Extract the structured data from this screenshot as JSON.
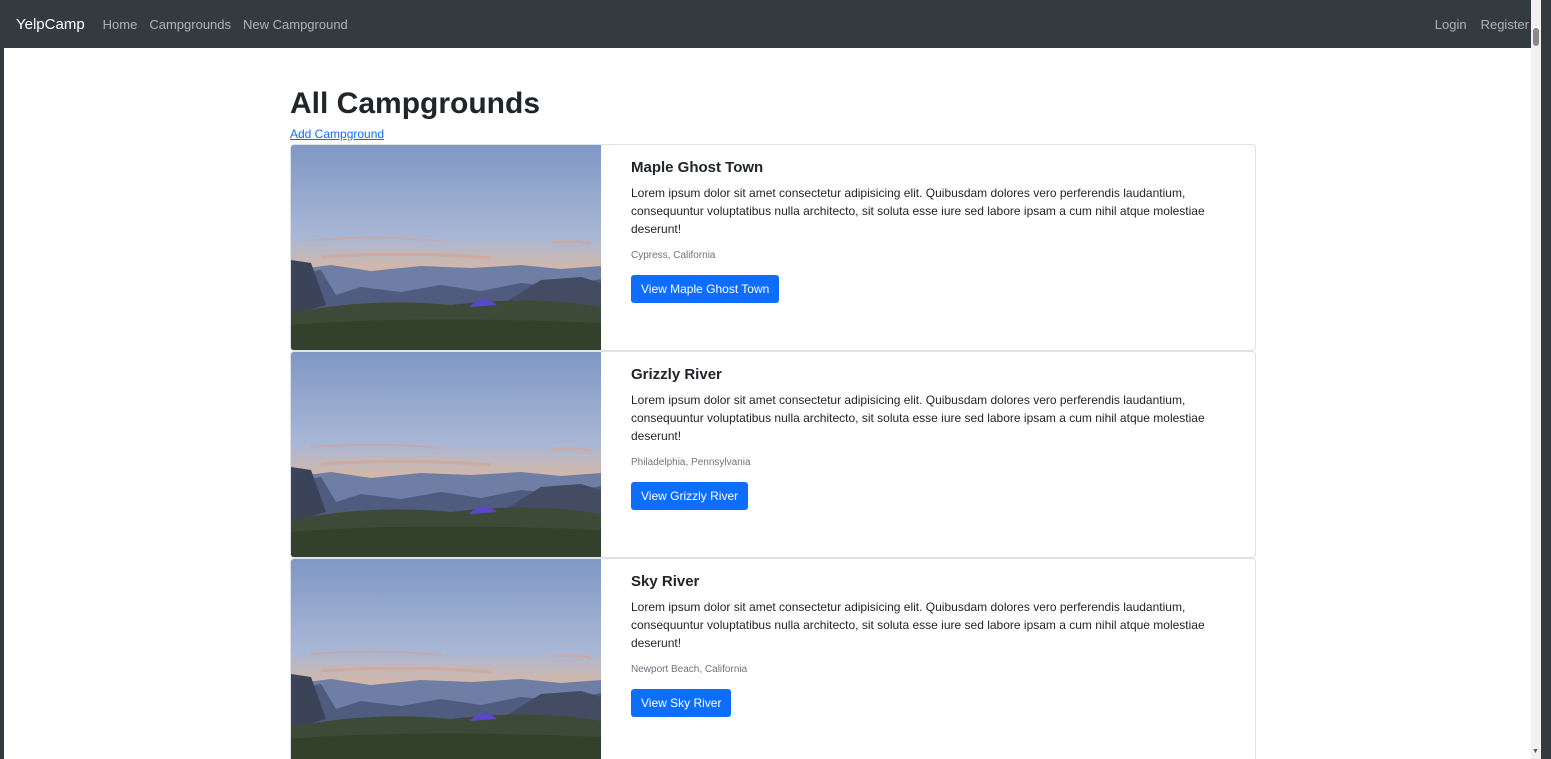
{
  "navbar": {
    "brand": "YelpCamp",
    "links": [
      "Home",
      "Campgrounds",
      "New Campground"
    ],
    "right_links": [
      "Login",
      "Register"
    ]
  },
  "page": {
    "title": "All Campgrounds",
    "add_link": "Add Campground"
  },
  "campgrounds": [
    {
      "title": "Maple Ghost Town",
      "description": "Lorem ipsum dolor sit amet consectetur adipisicing elit. Quibusdam dolores vero perferendis laudantium, consequuntur voluptatibus nulla architecto, sit soluta esse iure sed labore ipsam a cum nihil atque molestiae deserunt!",
      "location": "Cypress, California",
      "button": "View Maple Ghost Town"
    },
    {
      "title": "Grizzly River",
      "description": "Lorem ipsum dolor sit amet consectetur adipisicing elit. Quibusdam dolores vero perferendis laudantium, consequuntur voluptatibus nulla architecto, sit soluta esse iure sed labore ipsam a cum nihil atque molestiae deserunt!",
      "location": "Philadelphia, Pennsylvania",
      "button": "View Grizzly River"
    },
    {
      "title": "Sky River",
      "description": "Lorem ipsum dolor sit amet consectetur adipisicing elit. Quibusdam dolores vero perferendis laudantium, consequuntur voluptatibus nulla architecto, sit soluta esse iure sed labore ipsam a cum nihil atque molestiae deserunt!",
      "location": "Newport Beach, California",
      "button": "View Sky River"
    }
  ],
  "colors": {
    "navbar_bg": "#343a40",
    "primary": "#0d6efd",
    "muted": "#6c757d"
  }
}
